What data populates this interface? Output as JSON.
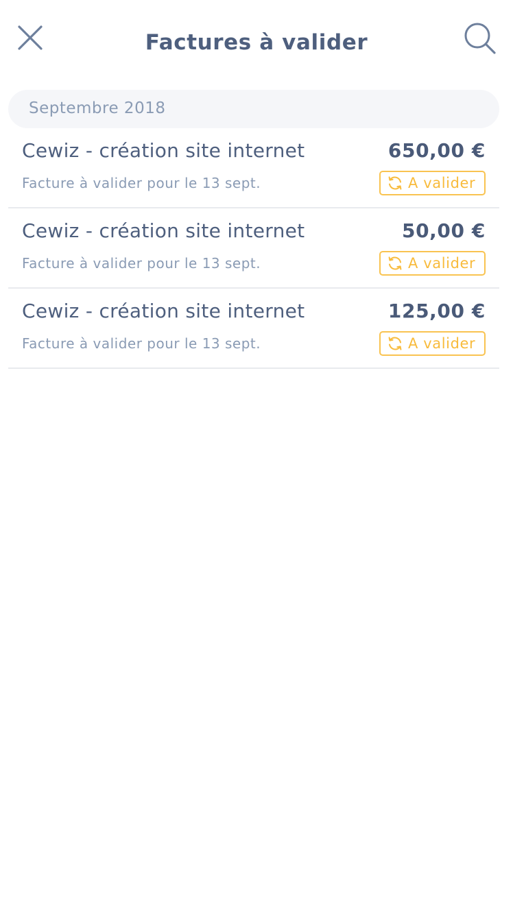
{
  "header": {
    "title": "Factures à valider",
    "close_icon": "close-icon",
    "search_icon": "search-icon"
  },
  "section": {
    "label": "Septembre 2018"
  },
  "invoices": [
    {
      "name": "Cewiz - création site internet",
      "due": "Facture à valider pour le 13 sept.",
      "amount": "650,00 €",
      "status": "A valider"
    },
    {
      "name": "Cewiz - création site internet",
      "due": "Facture à valider pour le 13 sept.",
      "amount": "50,00 €",
      "status": "A valider"
    },
    {
      "name": "Cewiz - création site internet",
      "due": "Facture à valider pour le 13 sept.",
      "amount": "125,00 €",
      "status": "A valider"
    }
  ],
  "colors": {
    "text_primary": "#4e5f7e",
    "text_secondary": "#8a9bb4",
    "status_accent": "#f9c350",
    "section_bg": "#f5f6f9",
    "divider": "#e8eaee"
  },
  "status_icon": "refresh-icon"
}
